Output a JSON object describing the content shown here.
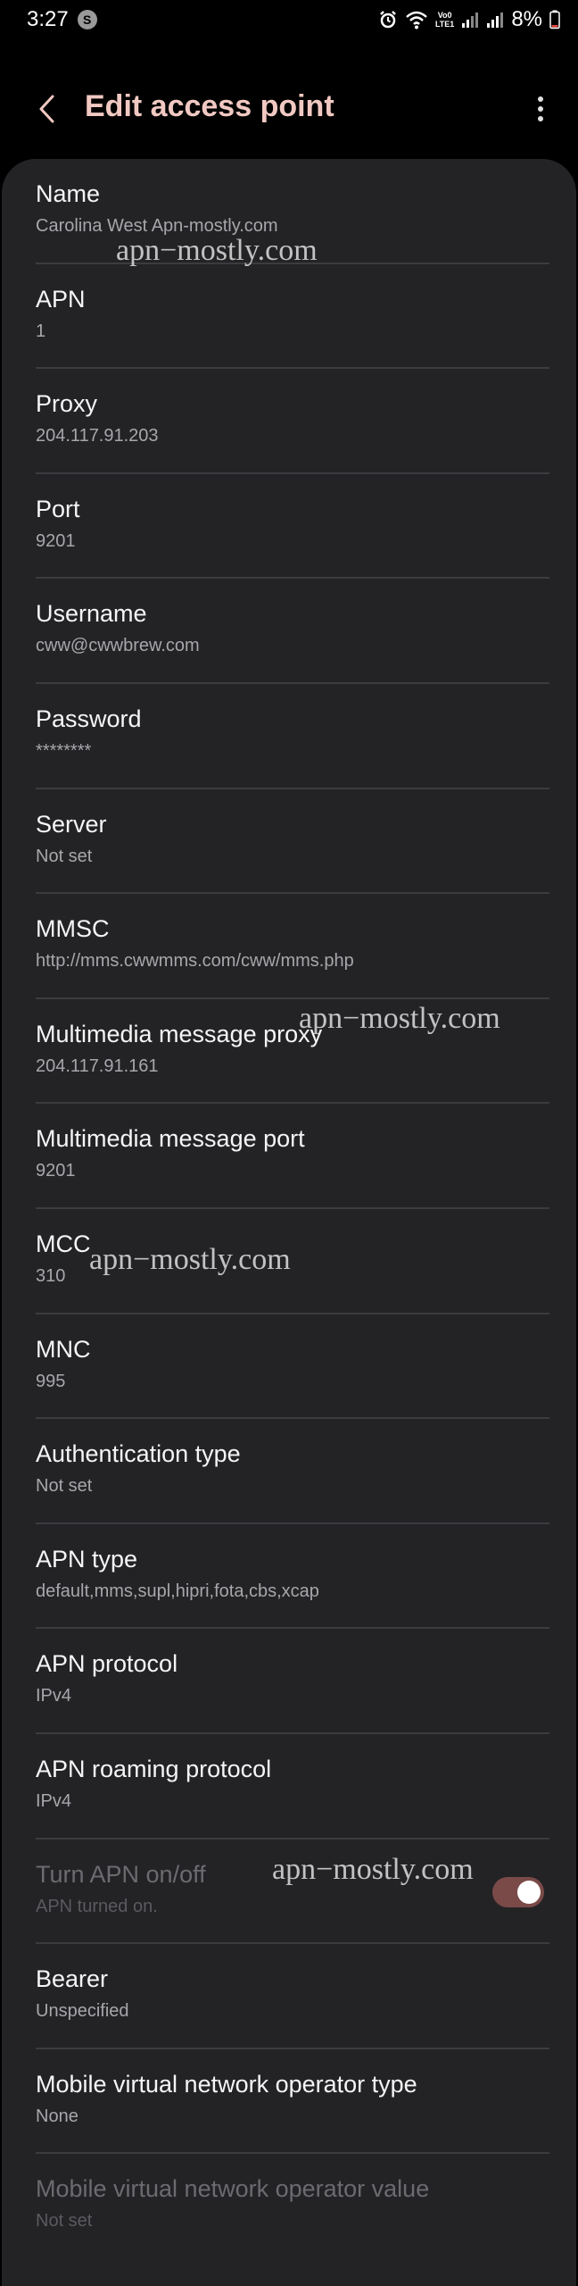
{
  "status_bar": {
    "time": "3:27",
    "notification_badge": "S",
    "network_label_top": "Vo0",
    "network_label_bottom": "LTE1",
    "battery": "8%",
    "icons": [
      "alarm-icon",
      "wifi-icon",
      "signal-icon",
      "signal-icon",
      "battery-icon"
    ]
  },
  "header": {
    "title": "Edit access point",
    "back_icon": "chevron-left-icon",
    "more_icon": "more-vertical-icon"
  },
  "colors": {
    "background": "#000000",
    "card": "#232326",
    "title_accent": "#f1c9c2",
    "toggle_on": "#7a4a48"
  },
  "items": [
    {
      "title": "Name",
      "value": "Carolina West Apn-mostly.com"
    },
    {
      "title": "APN",
      "value": "1"
    },
    {
      "title": "Proxy",
      "value": "204.117.91.203"
    },
    {
      "title": "Port",
      "value": "9201"
    },
    {
      "title": "Username",
      "value": "cww@cwwbrew.com"
    },
    {
      "title": "Password",
      "value": "********"
    },
    {
      "title": "Server",
      "value": "Not set"
    },
    {
      "title": "MMSC",
      "value": "http://mms.cwwmms.com/cww/mms.php"
    },
    {
      "title": "Multimedia message proxy",
      "value": "204.117.91.161"
    },
    {
      "title": "Multimedia message port",
      "value": "9201"
    },
    {
      "title": "MCC",
      "value": "310"
    },
    {
      "title": "MNC",
      "value": "995"
    },
    {
      "title": "Authentication type",
      "value": "Not set"
    },
    {
      "title": "APN type",
      "value": "default,mms,supl,hipri,fota,cbs,xcap"
    },
    {
      "title": "APN protocol",
      "value": "IPv4"
    },
    {
      "title": "APN roaming protocol",
      "value": "IPv4"
    },
    {
      "title": "Turn APN on/off",
      "value": "APN turned on.",
      "toggle_on": true
    },
    {
      "title": "Bearer",
      "value": "Unspecified"
    },
    {
      "title": "Mobile virtual network operator type",
      "value": "None"
    },
    {
      "title": "Mobile virtual network operator value",
      "value": "Not set"
    }
  ],
  "watermarks": [
    "apn−mostly.com",
    "apn−mostly.com",
    "apn−mostly.com",
    "apn−mostly.com"
  ]
}
